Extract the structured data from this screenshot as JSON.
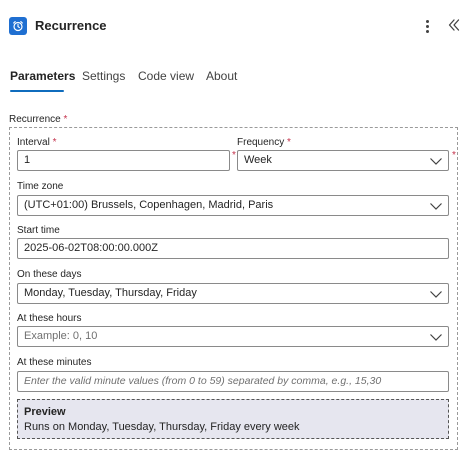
{
  "header": {
    "title": "Recurrence",
    "app_icon": "alarm-clock-icon",
    "accent_color": "#1f6fd1"
  },
  "tabs": [
    {
      "label": "Parameters",
      "active": true
    },
    {
      "label": "Settings",
      "active": false
    },
    {
      "label": "Code view",
      "active": false
    },
    {
      "label": "About",
      "active": false
    }
  ],
  "section": {
    "label": "Recurrence",
    "required_mark": "*"
  },
  "fields": {
    "interval": {
      "label": "Interval",
      "required_mark": "*",
      "value": "1"
    },
    "frequency": {
      "label": "Frequency",
      "required_mark": "*",
      "value": "Week"
    },
    "time_zone": {
      "label": "Time zone",
      "value": "(UTC+01:00) Brussels, Copenhagen, Madrid, Paris"
    },
    "start_time": {
      "label": "Start time",
      "value": "2025-06-02T08:00:00.000Z"
    },
    "on_these_days": {
      "label": "On these days",
      "value": "Monday, Tuesday, Thursday, Friday"
    },
    "at_these_hours": {
      "label": "At these hours",
      "placeholder": "Example: 0, 10"
    },
    "at_these_minutes": {
      "label": "At these minutes",
      "placeholder": "Enter the valid minute values (from 0 to 59) separated by comma, e.g., 15,30"
    }
  },
  "preview": {
    "title": "Preview",
    "text": "Runs on Monday, Tuesday, Thursday, Friday every week"
  },
  "colors": {
    "tab_underline": "#0f6cbd",
    "required": "#c4314b",
    "preview_bg": "#e6e6ef"
  }
}
